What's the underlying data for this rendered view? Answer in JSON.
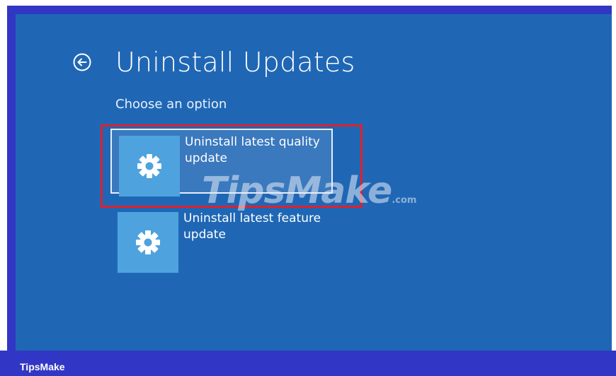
{
  "header": {
    "back_icon": "arrow-left-circle-icon",
    "title": "Uninstall Updates",
    "subtitle": "Choose an option"
  },
  "options": [
    {
      "label": "Uninstall latest quality update",
      "icon": "gear-icon",
      "selected": true
    },
    {
      "label": "Uninstall latest feature update",
      "icon": "gear-icon",
      "selected": false
    }
  ],
  "watermark": {
    "text": "TipsMake",
    "suffix": ".com"
  },
  "footer": {
    "brand": "TipsMake"
  },
  "colors": {
    "screen_bg": "#1f67b5",
    "tile_bg": "#4ea3de",
    "frame": "#3236c4",
    "highlight": "#e0202a"
  }
}
